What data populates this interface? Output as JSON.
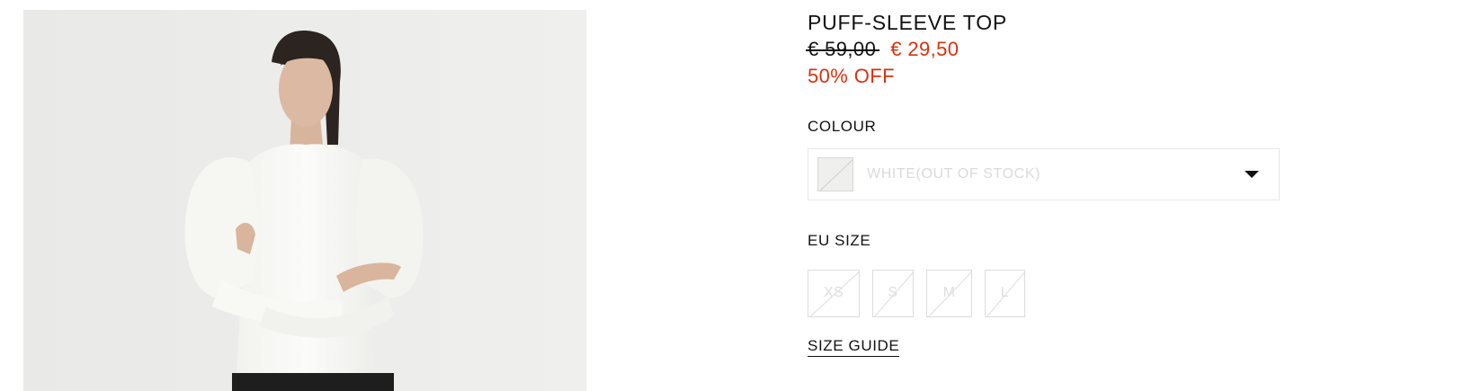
{
  "product": {
    "title": "PUFF-SLEEVE TOP",
    "price_original": "€ 59,00",
    "price_sale": "€ 29,50",
    "discount": "50% OFF",
    "sale_color": "#d6330f",
    "image_alt": "Model wearing white puff-sleeve top"
  },
  "colour": {
    "label": "COLOUR",
    "selected": "WHITE(OUT OF STOCK)",
    "icon": "chevron-down-icon"
  },
  "size": {
    "label": "EU SIZE",
    "options": [
      "XS",
      "S",
      "M",
      "L"
    ],
    "guide_label": "SIZE GUIDE"
  }
}
